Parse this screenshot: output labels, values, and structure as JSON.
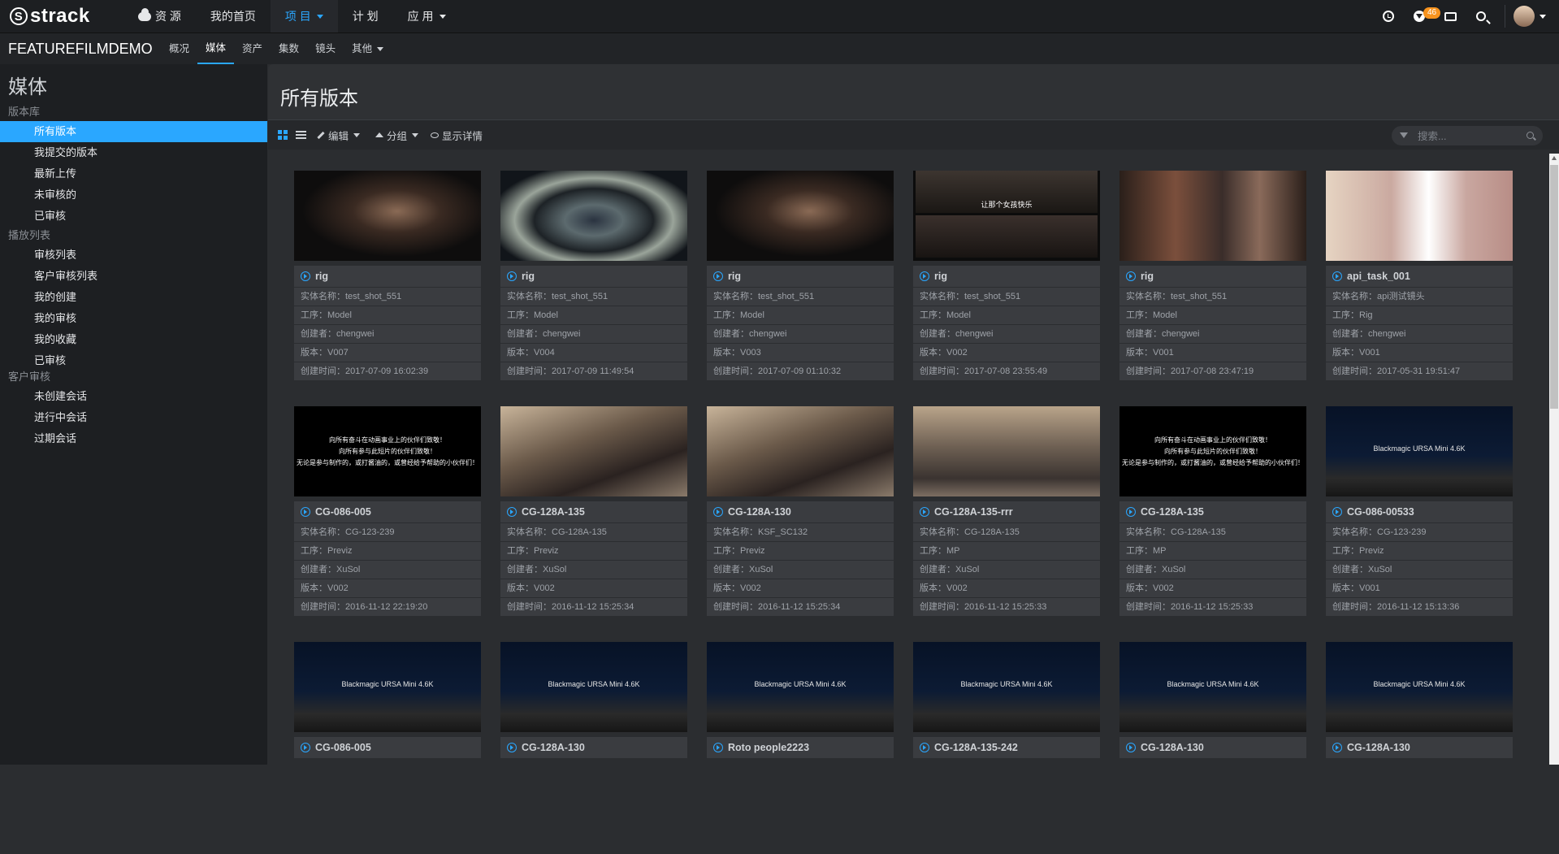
{
  "app": {
    "logo_text": "strack",
    "logo_mark": "S"
  },
  "topnav": [
    {
      "label": "资 源",
      "icon": "cloud-icon"
    },
    {
      "label": "我的首页"
    },
    {
      "label": "项 目",
      "dropdown": true,
      "active": true
    },
    {
      "label": "计 划"
    },
    {
      "label": "应 用",
      "dropdown": true
    }
  ],
  "tools": {
    "notification_count": "46"
  },
  "project": {
    "name": "FEATUREFILMDEMO",
    "tabs": [
      {
        "label": "概况"
      },
      {
        "label": "媒体",
        "active": true
      },
      {
        "label": "资产"
      },
      {
        "label": "集数"
      },
      {
        "label": "镜头"
      },
      {
        "label": "其他",
        "dropdown": true
      }
    ]
  },
  "sidebar": {
    "title": "媒体",
    "sections": [
      {
        "title": "版本库",
        "items": [
          "所有版本",
          "我提交的版本",
          "最新上传",
          "未审核的",
          "已审核"
        ]
      },
      {
        "title": "播放列表",
        "items": [
          "审核列表",
          "客户审核列表",
          "我的创建",
          "我的审核",
          "我的收藏",
          "已审核"
        ]
      },
      {
        "title": "客户审核",
        "items": [
          "未创建会话",
          "进行中会话",
          "过期会话"
        ]
      }
    ],
    "active_item": "所有版本"
  },
  "main": {
    "title": "所有版本",
    "toolbar": {
      "edit": "编辑",
      "group": "分组",
      "details": "显示详情"
    },
    "search_placeholder": "搜索..."
  },
  "labels": {
    "entity": "实体名称：",
    "step": "工序：",
    "creator": "创建者：",
    "version": "版本：",
    "created": "创建时间："
  },
  "credits_text": [
    "向所有奋斗在动画事业上的伙伴们致敬！",
    "向所有参与此短片的伙伴们致敬！",
    "无论是参与制作的，或打酱油的，或曾经给予帮助的小伙伴们！"
  ],
  "split_caption": "让那个女孩快乐",
  "camera_caption": "Blackmagic URSA Mini 4.6K",
  "cards": [
    {
      "title": "rig",
      "entity": "test_shot_551",
      "step": "Model",
      "creator": "chengwei",
      "version": "V007",
      "created": "2017-07-09 16:02:39",
      "thumb": "couple"
    },
    {
      "title": "rig",
      "entity": "test_shot_551",
      "step": "Model",
      "creator": "chengwei",
      "version": "V004",
      "created": "2017-07-09 11:49:54",
      "thumb": "tunnel"
    },
    {
      "title": "rig",
      "entity": "test_shot_551",
      "step": "Model",
      "creator": "chengwei",
      "version": "V003",
      "created": "2017-07-09 01:10:32",
      "thumb": "couple"
    },
    {
      "title": "rig",
      "entity": "test_shot_551",
      "step": "Model",
      "creator": "chengwei",
      "version": "V002",
      "created": "2017-07-08 23:55:49",
      "thumb": "split"
    },
    {
      "title": "rig",
      "entity": "test_shot_551",
      "step": "Model",
      "creator": "chengwei",
      "version": "V001",
      "created": "2017-07-08 23:47:19",
      "thumb": "party"
    },
    {
      "title": "api_task_001",
      "entity": "api测试镜头",
      "step": "Rig",
      "creator": "chengwei",
      "version": "V001",
      "created": "2017-05-31 19:51:47",
      "thumb": "lady"
    },
    {
      "title": "CG-086-005",
      "entity": "CG-123-239",
      "step": "Previz",
      "creator": "XuSol",
      "version": "V002",
      "created": "2016-11-12 22:19:20",
      "thumb": "credits"
    },
    {
      "title": "CG-128A-135",
      "entity": "CG-128A-135",
      "step": "Previz",
      "creator": "XuSol",
      "version": "V002",
      "created": "2016-11-12 15:25:34",
      "thumb": "autumn"
    },
    {
      "title": "CG-128A-130",
      "entity": "KSF_SC132",
      "step": "Previz",
      "creator": "XuSol",
      "version": "V002",
      "created": "2016-11-12 15:25:34",
      "thumb": "autumn"
    },
    {
      "title": "CG-128A-135-rrr",
      "entity": "CG-128A-135",
      "step": "MP",
      "creator": "XuSol",
      "version": "V002",
      "created": "2016-11-12 15:25:33",
      "thumb": "forest"
    },
    {
      "title": "CG-128A-135",
      "entity": "CG-128A-135",
      "step": "MP",
      "creator": "XuSol",
      "version": "V002",
      "created": "2016-11-12 15:25:33",
      "thumb": "credits"
    },
    {
      "title": "CG-086-00533",
      "entity": "CG-123-239",
      "step": "Previz",
      "creator": "XuSol",
      "version": "V001",
      "created": "2016-11-12 15:13:36",
      "thumb": "night"
    },
    {
      "title": "CG-086-005",
      "thumb": "night"
    },
    {
      "title": "CG-128A-130",
      "thumb": "night"
    },
    {
      "title": "Roto people2223",
      "thumb": "night"
    },
    {
      "title": "CG-128A-135-242",
      "thumb": "night"
    },
    {
      "title": "CG-128A-130",
      "thumb": "night"
    },
    {
      "title": "CG-128A-130",
      "thumb": "night"
    }
  ]
}
